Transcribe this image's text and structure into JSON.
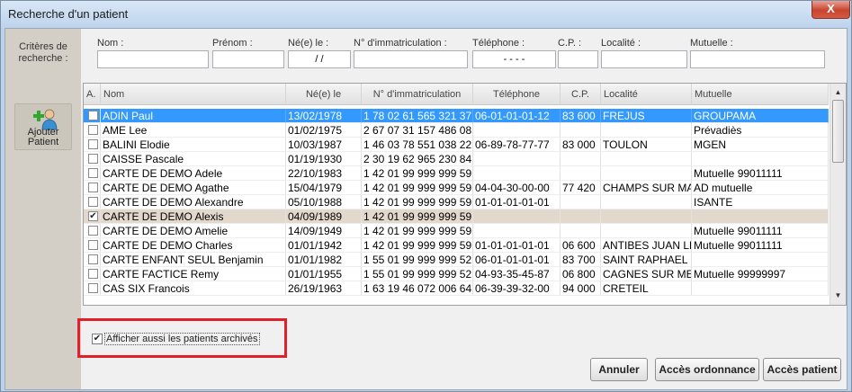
{
  "window": {
    "title": "Recherche d'un patient",
    "close_label": "X"
  },
  "sidebar": {
    "criteria_label": "Critères de recherche :",
    "add_patient_label": "Ajouter Patient"
  },
  "criteria": {
    "nom_label": "Nom :",
    "prenom_label": "Prénom :",
    "nee_label": "Né(e) le :",
    "immat_label": "N° d'immatriculation :",
    "telephone_label": "Téléphone :",
    "cp_label": "C.P. :",
    "localite_label": "Localité :",
    "mutuelle_label": "Mutuelle :",
    "nom_value": "",
    "prenom_value": "",
    "nee_value": "/ /",
    "immat_value": "",
    "telephone_value": "- - - -",
    "cp_value": "",
    "localite_value": "",
    "mutuelle_value": ""
  },
  "grid": {
    "columns": [
      "A.",
      "Nom",
      "Né(e) le",
      "N° d'immatriculation",
      "Téléphone",
      "C.P.",
      "Localité",
      "Mutuelle"
    ],
    "rows": [
      {
        "checked": false,
        "nom": "ADIN Paul",
        "nee": "13/02/1978",
        "immat": "1 78 02 61 565 321 37",
        "tel": "06-01-01-01-12",
        "cp": "83 600",
        "loc": "FREJUS",
        "mut": "GROUPAMA"
      },
      {
        "checked": false,
        "nom": "AME Lee",
        "nee": "01/02/1975",
        "immat": "2 67 07 31 157 486 08",
        "tel": "",
        "cp": "",
        "loc": "",
        "mut": "Prévadiès"
      },
      {
        "checked": false,
        "nom": "BALINI Elodie",
        "nee": "10/03/1987",
        "immat": "1 46 03 78 551 038 22",
        "tel": "06-89-78-77-77",
        "cp": "83 000",
        "loc": "TOULON",
        "mut": "MGEN"
      },
      {
        "checked": false,
        "nom": "CAISSE Pascale",
        "nee": "01/19/1930",
        "immat": "2 30 19 62 965 230 84",
        "tel": "",
        "cp": "",
        "loc": "",
        "mut": ""
      },
      {
        "checked": false,
        "nom": "CARTE DE DEMO Adele",
        "nee": "22/10/1983",
        "immat": "1 42 01 99 999 999 59",
        "tel": "",
        "cp": "",
        "loc": "",
        "mut": "Mutuelle 99011111"
      },
      {
        "checked": false,
        "nom": "CARTE DE DEMO Agathe",
        "nee": "15/04/1979",
        "immat": "1 42 01 99 999 999 59",
        "tel": "04-04-30-00-00",
        "cp": "77 420",
        "loc": "CHAMPS SUR MARNE",
        "mut": "AD mutuelle"
      },
      {
        "checked": false,
        "nom": "CARTE DE DEMO Alexandre",
        "nee": "05/10/1988",
        "immat": "1 42 01 99 999 999 59",
        "tel": "01-01-01-01-01",
        "cp": "",
        "loc": "",
        "mut": "ISANTE"
      },
      {
        "checked": true,
        "nom": "CARTE DE DEMO Alexis",
        "nee": "04/09/1989",
        "immat": "1 42 01 99 999 999 59",
        "tel": "",
        "cp": "",
        "loc": "",
        "mut": ""
      },
      {
        "checked": false,
        "nom": "CARTE DE DEMO Amelie",
        "nee": "14/09/1949",
        "immat": "1 42 01 99 999 999 59",
        "tel": "",
        "cp": "",
        "loc": "",
        "mut": "Mutuelle 99011111"
      },
      {
        "checked": false,
        "nom": "CARTE DE DEMO Charles",
        "nee": "01/01/1942",
        "immat": "1 42 01 99 999 999 59",
        "tel": "01-01-01-01-01",
        "cp": "06 600",
        "loc": "ANTIBES JUAN LES PINS",
        "mut": "Mutuelle 99011111"
      },
      {
        "checked": false,
        "nom": "CARTE ENFANT SEUL Benjamin",
        "nee": "01/01/1982",
        "immat": "1 55 01 99 999 999 52",
        "tel": "06-01-01-01-01",
        "cp": "83 700",
        "loc": "SAINT RAPHAEL",
        "mut": ""
      },
      {
        "checked": false,
        "nom": "CARTE FACTICE Remy",
        "nee": "01/01/1955",
        "immat": "1 55 01 99 999 999 52",
        "tel": "04-93-35-45-87",
        "cp": "06 800",
        "loc": "CAGNES SUR MER",
        "mut": "Mutuelle 99999997"
      },
      {
        "checked": false,
        "nom": "CAS SIX Francois",
        "nee": "26/19/1963",
        "immat": "1 63 19 46 072 006 64",
        "tel": "06-39-39-32-00",
        "cp": "94 000",
        "loc": "CRETEIL",
        "mut": ""
      }
    ]
  },
  "archive": {
    "label": "Afficher aussi les patients archivés",
    "checked": true
  },
  "buttons": {
    "annuler": "Annuler",
    "acces_ordonnance": "Accès ordonnance",
    "acces_patient": "Accès patient"
  },
  "colors": {
    "selection": "#3399ff",
    "highlight_box": "#e0202a",
    "checked_row": "#e2d8cc"
  }
}
